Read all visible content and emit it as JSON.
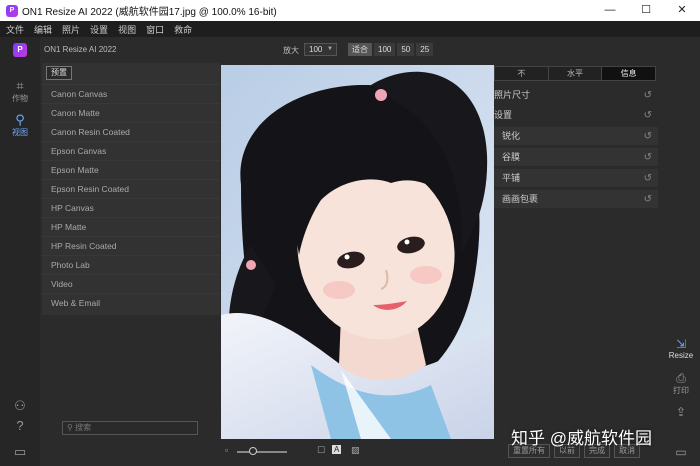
{
  "window": {
    "title": "ON1 Resize AI 2022 (威航软件园17.jpg @ 100.0% 16-bit)",
    "app_icon_text": "P",
    "controls": {
      "minimize": "—",
      "maximize": "☐",
      "close": "✕"
    }
  },
  "menu": [
    "文件",
    "编辑",
    "照片",
    "设置",
    "视图",
    "窗口",
    "救命"
  ],
  "left_rail": {
    "logo_text": "P",
    "items": [
      {
        "label": "作物",
        "icon": "crop-icon",
        "glyph": "⌗"
      },
      {
        "label": "视图",
        "icon": "view-search-icon",
        "glyph": "⚲"
      }
    ],
    "bottom_icons": [
      {
        "icon": "user-settings-icon",
        "glyph": "⚇"
      },
      {
        "icon": "help-icon",
        "glyph": "?"
      },
      {
        "icon": "panel-toggle-icon",
        "glyph": "▭"
      }
    ]
  },
  "toolbar": {
    "app_name": "ON1 Resize AI 2022",
    "zoom_label": "放大",
    "zoom_value": "100",
    "presets": [
      {
        "label": "适合",
        "active": true
      },
      {
        "label": "100",
        "active": false
      },
      {
        "label": "50",
        "active": false
      },
      {
        "label": "25",
        "active": false
      }
    ]
  },
  "presets_panel": {
    "tab_label": "预置",
    "items": [
      "Canon Canvas",
      "Canon Matte",
      "Canon Resin Coated",
      "Epson Canvas",
      "Epson Matte",
      "Epson Resin Coated",
      "HP Canvas",
      "HP Matte",
      "HP Resin Coated",
      "Photo Lab",
      "Video",
      "Web & Email"
    ],
    "search_placeholder": "搜索"
  },
  "right_panel": {
    "tabs": [
      {
        "label": "不",
        "active": false
      },
      {
        "label": "水平",
        "active": false
      },
      {
        "label": "信息",
        "active": true
      }
    ],
    "rows": [
      {
        "label": "照片尺寸",
        "level": "top"
      },
      {
        "label": "设置",
        "level": "top"
      },
      {
        "label": "锐化",
        "level": "sub"
      },
      {
        "label": "谷膜",
        "level": "sub"
      },
      {
        "label": "平铺",
        "level": "sub"
      },
      {
        "label": "画画包裹",
        "level": "sub"
      }
    ],
    "reset_glyph": "↺"
  },
  "right_rail": [
    {
      "label": "Resize",
      "icon": "resize-icon",
      "glyph": "⇲",
      "active": true
    },
    {
      "label": "打印",
      "icon": "print-icon",
      "glyph": "⎙",
      "active": false
    },
    {
      "label": "",
      "icon": "share-icon",
      "glyph": "⇪",
      "active": false
    },
    {
      "label": "",
      "icon": "panel-right-icon",
      "glyph": "▭",
      "active": false
    }
  ],
  "bottom_center": {
    "left_icon": "▫",
    "right_icons": [
      "☐",
      "A",
      "▨"
    ]
  },
  "bottom_buttons": [
    "重置所有",
    "以前",
    "完成",
    "取消"
  ],
  "watermark": "知乎 @威航软件园",
  "colors": {
    "accent": "#6aa9ff",
    "brand": "#8a3cff"
  }
}
